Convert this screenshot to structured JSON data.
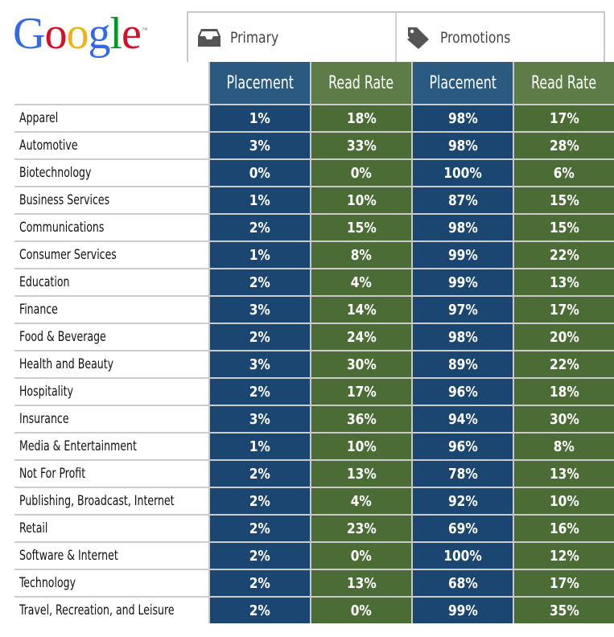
{
  "logo": {
    "letters": [
      "G",
      "o",
      "o",
      "g",
      "l",
      "e"
    ],
    "colors": [
      "#3369e8",
      "#d50f25",
      "#eeb211",
      "#3369e8",
      "#009925",
      "#d50f25"
    ],
    "tm": "™"
  },
  "tabs": [
    {
      "label": "Primary",
      "icon": "inbox-tray-icon"
    },
    {
      "label": "Promotions",
      "icon": "tag-icon"
    }
  ],
  "colors": {
    "placement_header": "#2b5a80",
    "readrate_header": "#5e7c48",
    "placement_cell": "#1b4671",
    "readrate_cell": "#4b6d35"
  },
  "chart_data": {
    "type": "table",
    "title": "",
    "groups": [
      "Primary",
      "Promotions"
    ],
    "columns": [
      "Placement",
      "Read Rate",
      "Placement",
      "Read Rate"
    ],
    "rows": [
      {
        "industry": "Apparel",
        "values": [
          "1%",
          "18%",
          "98%",
          "17%"
        ]
      },
      {
        "industry": "Automotive",
        "values": [
          "3%",
          "33%",
          "98%",
          "28%"
        ]
      },
      {
        "industry": "Biotechnology",
        "values": [
          "0%",
          "0%",
          "100%",
          "6%"
        ]
      },
      {
        "industry": "Business Services",
        "values": [
          "1%",
          "10%",
          "87%",
          "15%"
        ]
      },
      {
        "industry": "Communications",
        "values": [
          "2%",
          "15%",
          "98%",
          "15%"
        ]
      },
      {
        "industry": "Consumer Services",
        "values": [
          "1%",
          "8%",
          "99%",
          "22%"
        ]
      },
      {
        "industry": "Education",
        "values": [
          "2%",
          "4%",
          "99%",
          "13%"
        ]
      },
      {
        "industry": "Finance",
        "values": [
          "3%",
          "14%",
          "97%",
          "17%"
        ]
      },
      {
        "industry": "Food & Beverage",
        "values": [
          "2%",
          "24%",
          "98%",
          "20%"
        ]
      },
      {
        "industry": "Health and Beauty",
        "values": [
          "3%",
          "30%",
          "89%",
          "22%"
        ]
      },
      {
        "industry": "Hospitality",
        "values": [
          "2%",
          "17%",
          "96%",
          "18%"
        ]
      },
      {
        "industry": "Insurance",
        "values": [
          "3%",
          "36%",
          "94%",
          "30%"
        ]
      },
      {
        "industry": "Media & Entertainment",
        "values": [
          "1%",
          "10%",
          "96%",
          "8%"
        ]
      },
      {
        "industry": "Not For Profit",
        "values": [
          "2%",
          "13%",
          "78%",
          "13%"
        ]
      },
      {
        "industry": "Publishing, Broadcast, Internet",
        "values": [
          "2%",
          "4%",
          "92%",
          "10%"
        ]
      },
      {
        "industry": "Retail",
        "values": [
          "2%",
          "23%",
          "69%",
          "16%"
        ]
      },
      {
        "industry": "Software & Internet",
        "values": [
          "2%",
          "0%",
          "100%",
          "12%"
        ]
      },
      {
        "industry": "Technology",
        "values": [
          "2%",
          "13%",
          "68%",
          "17%"
        ]
      },
      {
        "industry": "Travel, Recreation, and Leisure",
        "values": [
          "2%",
          "0%",
          "99%",
          "35%"
        ]
      }
    ]
  }
}
